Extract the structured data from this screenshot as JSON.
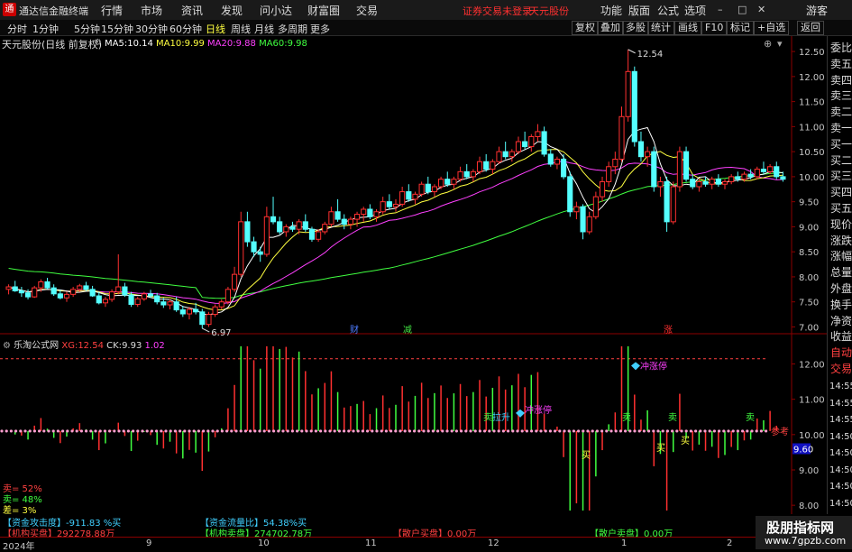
{
  "titlebar": {
    "logo": "通",
    "app_name": "通达信金融终端",
    "menus": [
      "行情",
      "市场",
      "资讯",
      "发现",
      "问小达",
      "财富圈",
      "交易"
    ],
    "alert": "证券交易未登录",
    "stock": "天元股份",
    "right_menus": [
      "功能",
      "版面",
      "公式",
      "选项"
    ],
    "guest": "游客"
  },
  "periods": {
    "items": [
      "分时",
      "1分钟",
      "5分钟",
      "15分钟",
      "30分钟",
      "60分钟",
      "日线",
      "周线",
      "月线",
      "多周期",
      "更多"
    ],
    "active": "日线",
    "tools": [
      "复权",
      "叠加",
      "多股",
      "统计",
      "画线",
      "F10",
      "标记",
      "+自选",
      "返回"
    ]
  },
  "main_chart": {
    "name": "天元股份(日线 前复权)",
    "ma": [
      {
        "label": "MA5:",
        "value": "10.14",
        "color": "#ffffff"
      },
      {
        "label": "MA10:",
        "value": "9.99",
        "color": "#ffff40"
      },
      {
        "label": "MA20:",
        "value": "9.88",
        "color": "#ff40ff"
      },
      {
        "label": "MA60:",
        "value": "9.98",
        "color": "#40ff40"
      }
    ],
    "y_ticks": [
      "12.50",
      "12.00",
      "11.50",
      "11.00",
      "10.50",
      "10.00",
      "9.50",
      "9.00",
      "8.50",
      "8.00",
      "7.50",
      "7.00"
    ],
    "high_label": "12.54",
    "low_label": "6.97",
    "events": [
      {
        "text": "财",
        "color": "#4d7cff"
      },
      {
        "text": "减",
        "color": "#40e040"
      },
      {
        "text": "涨",
        "color": "#ff3030"
      }
    ]
  },
  "indicator": {
    "name": "乐淘公式网",
    "xg_label": "XG:",
    "xg_value": "12.54",
    "ck_label": "CK:",
    "ck_value": "9.93",
    "third_value": "1.02",
    "y_ticks": [
      "12.00",
      "11.00",
      "10.00",
      "9.00",
      "8.00"
    ],
    "current_value": "9.60",
    "ref_label": "参考",
    "signals": [
      "卖",
      "拉升",
      "冲涨停",
      "冲涨停",
      "卖",
      "卖",
      "卖",
      "买",
      "买",
      "买"
    ],
    "sell_pct": "卖= 52%",
    "buy_pct": "卖= 48%",
    "diff_pct": "差= 3%"
  },
  "stats": {
    "row1": [
      {
        "label": "【资金攻击度】",
        "value": "-911.83 %买",
        "color": "#40d0ff"
      },
      {
        "label": "【资金流量比】",
        "value": "54.38%买",
        "color": "#40d0ff"
      }
    ],
    "row2": [
      {
        "label": "【机构买盘】",
        "value": "292278.88万",
        "color": "#ff4040"
      },
      {
        "label": "【机构卖盘】",
        "value": "274702.78万",
        "color": "#40ff40"
      },
      {
        "label": "【散户买盘】",
        "value": "0.00万",
        "color": "#ff4040"
      },
      {
        "label": "【散户卖盘】",
        "value": "0.00万",
        "color": "#40ff40"
      }
    ]
  },
  "dates": [
    "2024年",
    "9",
    "10",
    "11",
    "12",
    "1",
    "2"
  ],
  "right_panel": {
    "items": [
      "委比",
      "卖五",
      "卖四",
      "卖三",
      "卖二",
      "卖一",
      "买一",
      "买二",
      "买三",
      "买四",
      "买五",
      "现价",
      "涨跌",
      "涨幅",
      "总量",
      "外盘",
      "换手",
      "净资",
      "收益",
      "自动",
      "交易"
    ],
    "times": [
      "14:55",
      "14:55",
      "14:55",
      "14:50",
      "14:50",
      "14:50",
      "14:50",
      "14:50",
      "14:50"
    ]
  },
  "watermark": {
    "title": "股朋指标网",
    "url": "www.7gpzb.com"
  },
  "chart_data": {
    "type": "candlestick",
    "x_range": [
      "2024-08",
      "2025-02"
    ],
    "ylim": [
      6.9,
      12.7
    ],
    "ohlc": [
      [
        7.75,
        7.85,
        7.65,
        7.8
      ],
      [
        7.8,
        7.92,
        7.7,
        7.72
      ],
      [
        7.72,
        7.8,
        7.6,
        7.68
      ],
      [
        7.68,
        7.75,
        7.55,
        7.6
      ],
      [
        7.6,
        7.82,
        7.58,
        7.78
      ],
      [
        7.78,
        7.95,
        7.7,
        7.9
      ],
      [
        7.9,
        7.98,
        7.75,
        7.78
      ],
      [
        7.78,
        7.85,
        7.62,
        7.66
      ],
      [
        7.66,
        7.74,
        7.55,
        7.58
      ],
      [
        7.58,
        7.7,
        7.5,
        7.65
      ],
      [
        7.65,
        7.8,
        7.6,
        7.75
      ],
      [
        7.75,
        7.86,
        7.7,
        7.82
      ],
      [
        7.82,
        7.9,
        7.72,
        7.75
      ],
      [
        7.75,
        7.82,
        7.6,
        7.62
      ],
      [
        7.62,
        7.7,
        7.45,
        7.48
      ],
      [
        7.48,
        7.6,
        7.4,
        7.55
      ],
      [
        7.55,
        7.75,
        7.5,
        7.7
      ],
      [
        7.7,
        8.45,
        7.65,
        7.8
      ],
      [
        7.8,
        7.88,
        7.6,
        7.64
      ],
      [
        7.64,
        7.7,
        7.4,
        7.45
      ],
      [
        7.45,
        7.6,
        7.4,
        7.56
      ],
      [
        7.56,
        7.7,
        7.52,
        7.66
      ],
      [
        7.66,
        7.74,
        7.58,
        7.62
      ],
      [
        7.62,
        7.68,
        7.45,
        7.5
      ],
      [
        7.5,
        7.58,
        7.38,
        7.44
      ],
      [
        7.44,
        7.55,
        7.35,
        7.5
      ],
      [
        7.5,
        7.6,
        7.3,
        7.34
      ],
      [
        7.34,
        7.42,
        7.2,
        7.26
      ],
      [
        7.26,
        7.4,
        7.15,
        7.35
      ],
      [
        7.35,
        7.48,
        7.25,
        7.3
      ],
      [
        7.3,
        7.36,
        6.97,
        7.05
      ],
      [
        7.05,
        7.3,
        7.0,
        7.25
      ],
      [
        7.25,
        7.45,
        7.2,
        7.4
      ],
      [
        7.4,
        7.55,
        7.35,
        7.5
      ],
      [
        7.5,
        7.8,
        7.45,
        7.75
      ],
      [
        7.75,
        8.2,
        7.7,
        8.05
      ],
      [
        8.05,
        9.3,
        8.0,
        9.1
      ],
      [
        9.1,
        9.3,
        8.6,
        8.7
      ],
      [
        8.7,
        8.8,
        8.4,
        8.5
      ],
      [
        8.5,
        8.6,
        8.3,
        8.45
      ],
      [
        8.45,
        9.4,
        8.4,
        9.2
      ],
      [
        9.2,
        9.6,
        9.05,
        9.1
      ],
      [
        9.1,
        9.2,
        8.85,
        8.9
      ],
      [
        8.9,
        9.05,
        8.8,
        9.0
      ],
      [
        9.0,
        9.1,
        8.9,
        8.95
      ],
      [
        8.95,
        9.15,
        8.85,
        9.1
      ],
      [
        9.1,
        9.25,
        8.9,
        8.95
      ],
      [
        8.95,
        9.0,
        8.7,
        8.75
      ],
      [
        8.75,
        8.95,
        8.7,
        8.9
      ],
      [
        8.9,
        9.1,
        8.85,
        9.05
      ],
      [
        9.05,
        9.4,
        9.0,
        9.3
      ],
      [
        9.3,
        9.55,
        9.1,
        9.15
      ],
      [
        9.15,
        9.25,
        8.95,
        9.05
      ],
      [
        9.05,
        9.2,
        8.95,
        9.15
      ],
      [
        9.15,
        9.3,
        9.0,
        9.25
      ],
      [
        9.25,
        9.4,
        9.1,
        9.35
      ],
      [
        9.35,
        9.45,
        9.15,
        9.2
      ],
      [
        9.2,
        9.35,
        9.1,
        9.3
      ],
      [
        9.3,
        9.6,
        9.25,
        9.5
      ],
      [
        9.5,
        9.65,
        9.35,
        9.4
      ],
      [
        9.4,
        9.55,
        9.3,
        9.45
      ],
      [
        9.45,
        9.8,
        9.4,
        9.7
      ],
      [
        9.7,
        9.85,
        9.5,
        9.55
      ],
      [
        9.55,
        9.7,
        9.45,
        9.65
      ],
      [
        9.65,
        9.9,
        9.6,
        9.85
      ],
      [
        9.85,
        10.0,
        9.65,
        9.7
      ],
      [
        9.7,
        9.85,
        9.6,
        9.8
      ],
      [
        9.8,
        10.0,
        9.75,
        9.95
      ],
      [
        9.95,
        10.1,
        9.8,
        9.85
      ],
      [
        9.85,
        10.0,
        9.75,
        9.95
      ],
      [
        9.95,
        10.2,
        9.9,
        10.1
      ],
      [
        10.1,
        10.25,
        9.95,
        10.0
      ],
      [
        10.0,
        10.15,
        9.9,
        10.1
      ],
      [
        10.1,
        10.4,
        10.05,
        10.3
      ],
      [
        10.3,
        10.45,
        10.1,
        10.15
      ],
      [
        10.15,
        10.35,
        10.05,
        10.3
      ],
      [
        10.3,
        10.6,
        10.25,
        10.5
      ],
      [
        10.5,
        10.7,
        10.35,
        10.4
      ],
      [
        10.4,
        10.55,
        10.3,
        10.5
      ],
      [
        10.5,
        10.8,
        10.45,
        10.7
      ],
      [
        10.7,
        10.9,
        10.55,
        10.6
      ],
      [
        10.6,
        10.85,
        10.5,
        10.8
      ],
      [
        10.8,
        11.05,
        10.7,
        10.9
      ],
      [
        10.9,
        11.0,
        10.4,
        10.45
      ],
      [
        10.45,
        10.55,
        10.2,
        10.25
      ],
      [
        10.25,
        10.4,
        10.15,
        10.35
      ],
      [
        10.35,
        10.45,
        9.95,
        10.0
      ],
      [
        10.0,
        10.1,
        9.2,
        9.3
      ],
      [
        9.3,
        9.5,
        9.15,
        9.4
      ],
      [
        9.4,
        9.45,
        8.75,
        8.9
      ],
      [
        8.9,
        9.3,
        8.85,
        9.2
      ],
      [
        9.2,
        9.7,
        9.15,
        9.6
      ],
      [
        9.6,
        10.0,
        9.5,
        9.9
      ],
      [
        9.9,
        10.3,
        9.8,
        10.2
      ],
      [
        10.2,
        10.5,
        10.05,
        10.35
      ],
      [
        10.35,
        11.4,
        10.3,
        11.2
      ],
      [
        11.2,
        12.54,
        11.1,
        12.1
      ],
      [
        12.1,
        12.2,
        10.6,
        10.7
      ],
      [
        10.7,
        10.9,
        10.3,
        10.4
      ],
      [
        10.4,
        10.6,
        10.2,
        10.5
      ],
      [
        10.5,
        10.6,
        9.7,
        9.8
      ],
      [
        9.8,
        10.0,
        9.6,
        9.9
      ],
      [
        9.9,
        10.0,
        8.9,
        9.1
      ],
      [
        9.1,
        9.9,
        9.05,
        9.8
      ],
      [
        9.8,
        10.6,
        9.7,
        10.5
      ],
      [
        10.5,
        10.6,
        9.9,
        9.95
      ],
      [
        9.95,
        10.05,
        9.75,
        9.8
      ],
      [
        9.8,
        9.95,
        9.7,
        9.9
      ],
      [
        9.9,
        10.0,
        9.8,
        9.85
      ],
      [
        9.85,
        10.0,
        9.75,
        9.95
      ],
      [
        9.95,
        10.05,
        9.8,
        9.85
      ],
      [
        9.85,
        9.95,
        9.75,
        9.9
      ],
      [
        9.9,
        10.05,
        9.85,
        10.0
      ],
      [
        10.0,
        10.1,
        9.9,
        9.95
      ],
      [
        9.95,
        10.1,
        9.9,
        10.05
      ],
      [
        10.05,
        10.15,
        9.95,
        10.0
      ],
      [
        10.0,
        10.2,
        9.95,
        10.15
      ],
      [
        10.15,
        10.3,
        10.05,
        10.1
      ],
      [
        10.1,
        10.25,
        10.05,
        10.2
      ],
      [
        10.2,
        10.3,
        9.95,
        10.0
      ],
      [
        10.0,
        10.1,
        9.9,
        9.95
      ]
    ]
  }
}
